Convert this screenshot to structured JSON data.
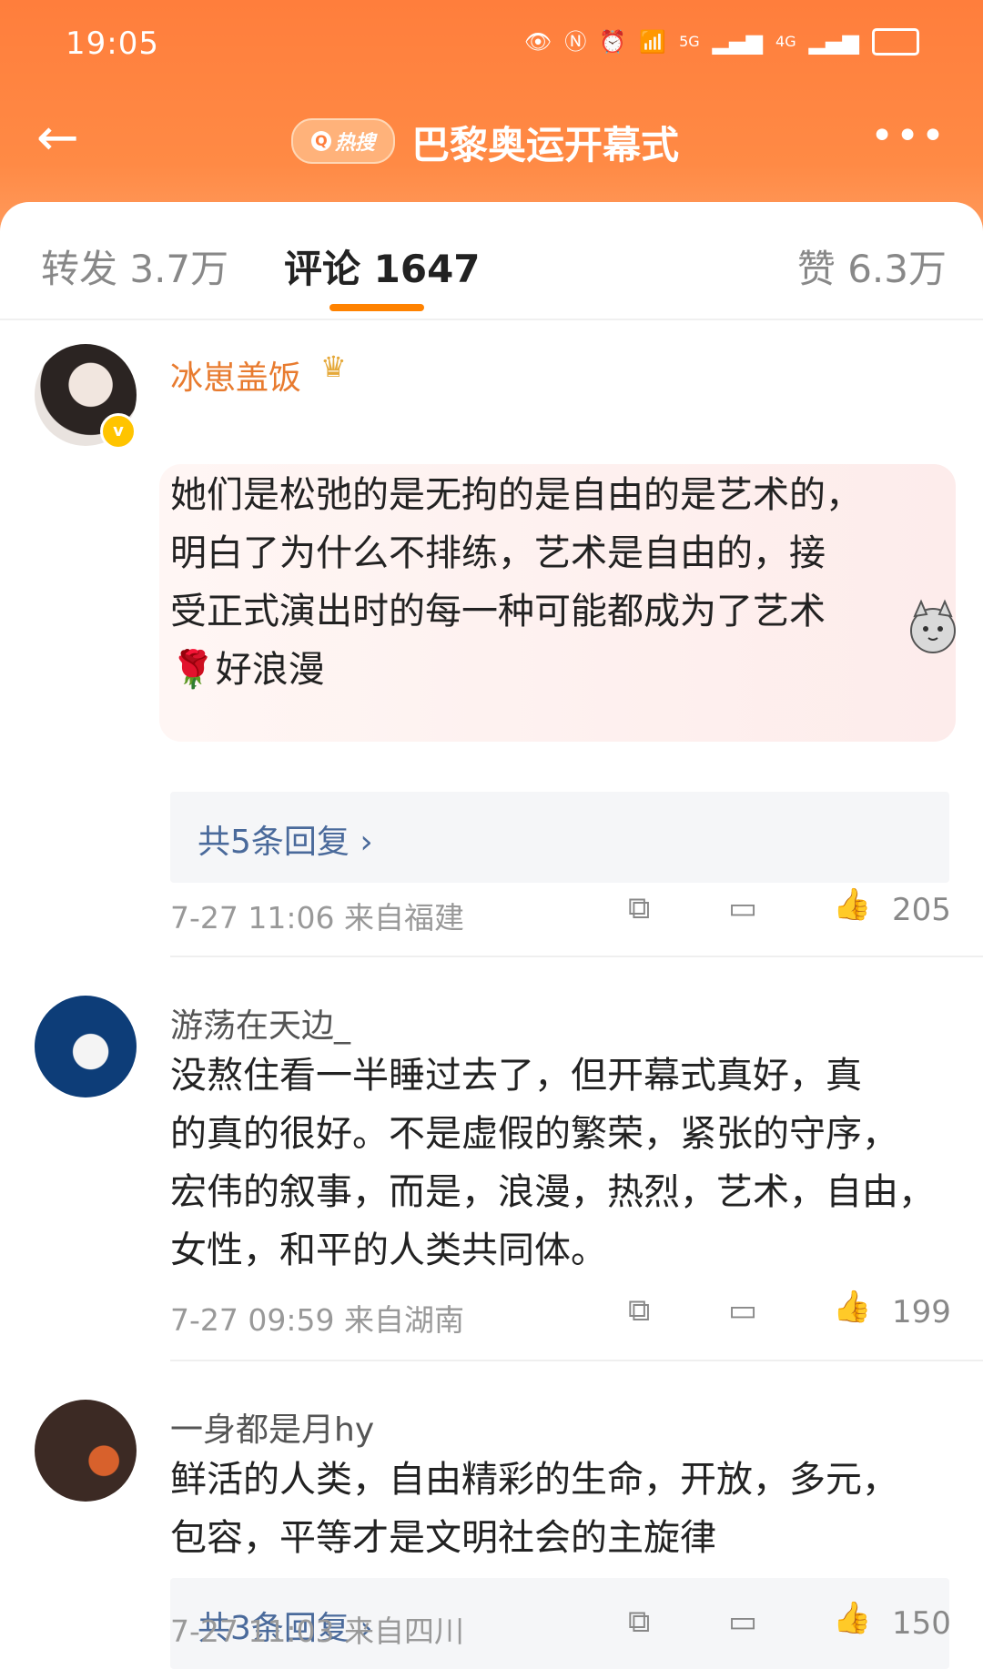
{
  "status": {
    "time": "19:05",
    "net1": "5G",
    "net2": "4G"
  },
  "nav": {
    "badge": "热搜",
    "title": "巴黎奥运开幕式"
  },
  "tabs": {
    "repost": "转发 3.7万",
    "comments": "评论 1647",
    "likes": "赞 6.3万"
  },
  "comments": [
    {
      "user": "冰崽盖饭",
      "text": "她们是松弛的是无拘的是自由的是艺术的，明白了为什么不排练，艺术是自由的，接受正式演出时的每一种可能都成为了艺术🌹好浪漫",
      "lines": [
        "她们是松弛的是无拘的是自由的是艺术的，",
        "明白了为什么不排练，艺术是自由的，接",
        "受正式演出时的每一种可能都成为了艺术",
        "🌹好浪漫"
      ],
      "replies": "共5条回复 ›",
      "meta": "7-27 11:06 来自福建",
      "likes": "205"
    },
    {
      "user": "游荡在天边_",
      "lines": [
        "没熬住看一半睡过去了，但开幕式真好，真",
        "的真的很好。不是虚假的繁荣，紧张的守序，",
        "宏伟的叙事，而是，浪漫，热烈，艺术，自由，",
        "女性，和平的人类共同体。"
      ],
      "meta": "7-27 09:59 来自湖南",
      "likes": "199"
    },
    {
      "user": "一身都是月hy",
      "lines": [
        "鲜活的人类，自由精彩的生命，开放，多元，",
        "包容，平等才是文明社会的主旋律"
      ],
      "replies": "共3条回复 ›",
      "meta": "7-27 11:03 来自四川",
      "likes": "150"
    }
  ],
  "colors": {
    "header": "#ff7e3c",
    "link": "#4a6a9b",
    "user_vip": "#e87b2f",
    "indicator": "#ff8200"
  }
}
